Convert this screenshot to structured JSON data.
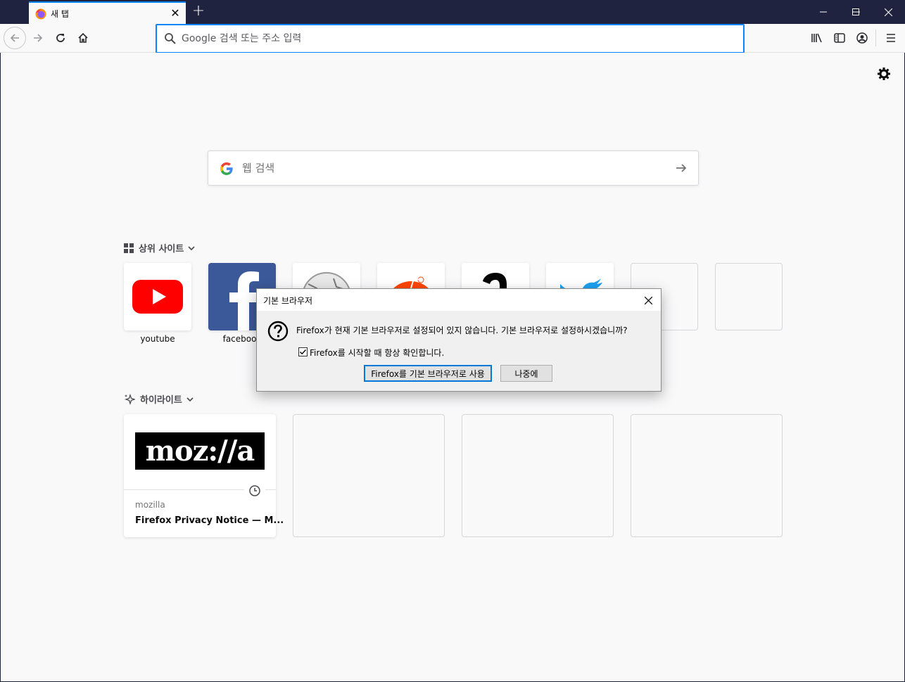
{
  "tabbar": {
    "tab_title": "새 탭",
    "new_tab": "+",
    "window_controls": [
      "minimize",
      "maximize",
      "close"
    ]
  },
  "navbar": {
    "url_placeholder": "Google 검색 또는 주소 입력",
    "icons": [
      "back-icon",
      "forward-icon",
      "reload-icon",
      "home-icon",
      "library-icon",
      "sidebar-icon",
      "account-icon",
      "menu-icon"
    ]
  },
  "search": {
    "placeholder": "웹 검색"
  },
  "top_sites": {
    "title": "상위 사이트",
    "tiles": [
      {
        "label": "youtube"
      },
      {
        "label": "facebook"
      },
      {
        "label": ""
      },
      {
        "label": ""
      },
      {
        "label": ""
      },
      {
        "label": ""
      }
    ]
  },
  "highlights": {
    "title": "하이라이트",
    "cards": [
      {
        "logo": "moz://a",
        "host": "mozilla",
        "title": "Firefox Privacy Notice — M..."
      }
    ]
  },
  "dialog": {
    "title": "기본 브라우저",
    "message": "Firefox가 현재 기본 브라우저로 설정되어 있지 않습니다. 기본 브라우저로 설정하시겠습니까?",
    "checkbox_label": "Firefox를 시작할 때 항상 확인합니다.",
    "checkbox_checked": true,
    "primary_button": "Firefox를 기본 브라우저로 사용",
    "secondary_button": "나중에"
  },
  "colors": {
    "frame": "#202340",
    "accent": "#0a84ff",
    "youtube_red": "#ff0000",
    "facebook_blue": "#3b5998",
    "twitter_blue": "#1da1f2",
    "reddit_orange": "#ff4500"
  }
}
